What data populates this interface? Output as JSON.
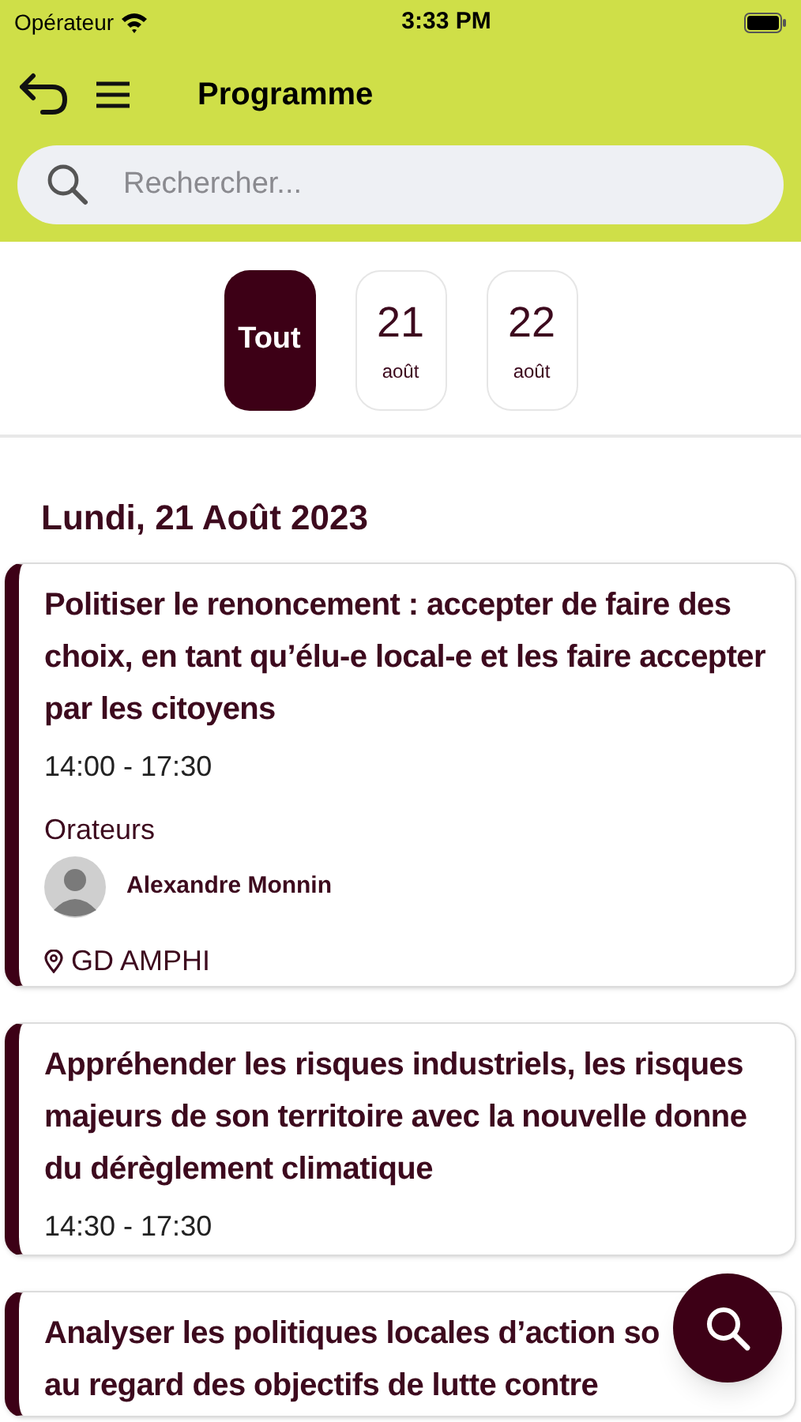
{
  "status_bar": {
    "carrier": "Opérateur",
    "time": "3:33 PM"
  },
  "header": {
    "title": "Programme"
  },
  "search": {
    "placeholder": "Rechercher..."
  },
  "day_tabs": [
    {
      "kind": "all",
      "label": "Tout",
      "selected": true
    },
    {
      "kind": "date",
      "day": "21",
      "month": "août",
      "selected": false
    },
    {
      "kind": "date",
      "day": "22",
      "month": "août",
      "selected": false
    }
  ],
  "day_heading": "Lundi, 21 Août 2023",
  "sessions": [
    {
      "title_lines": [
        "Politiser le renoncement : accepter de faire des choix, en tant qu’élu-e local-e et les faire accepter par les citoyens"
      ],
      "time": "14:00 - 17:30",
      "speakers_label": "Orateurs",
      "speakers": [
        {
          "name": "Alexandre Monnin"
        }
      ],
      "location": "GD AMPHI"
    },
    {
      "title_lines": [
        "Appréhender les risques industriels, les risques majeurs de son territoire avec la nouvelle donne du dérèglement climatique"
      ],
      "time": "14:30 - 17:30"
    },
    {
      "title_lines": [
        "Analyser les politiques locales d’action so",
        "au regard des objectifs de lutte contre"
      ]
    }
  ]
}
